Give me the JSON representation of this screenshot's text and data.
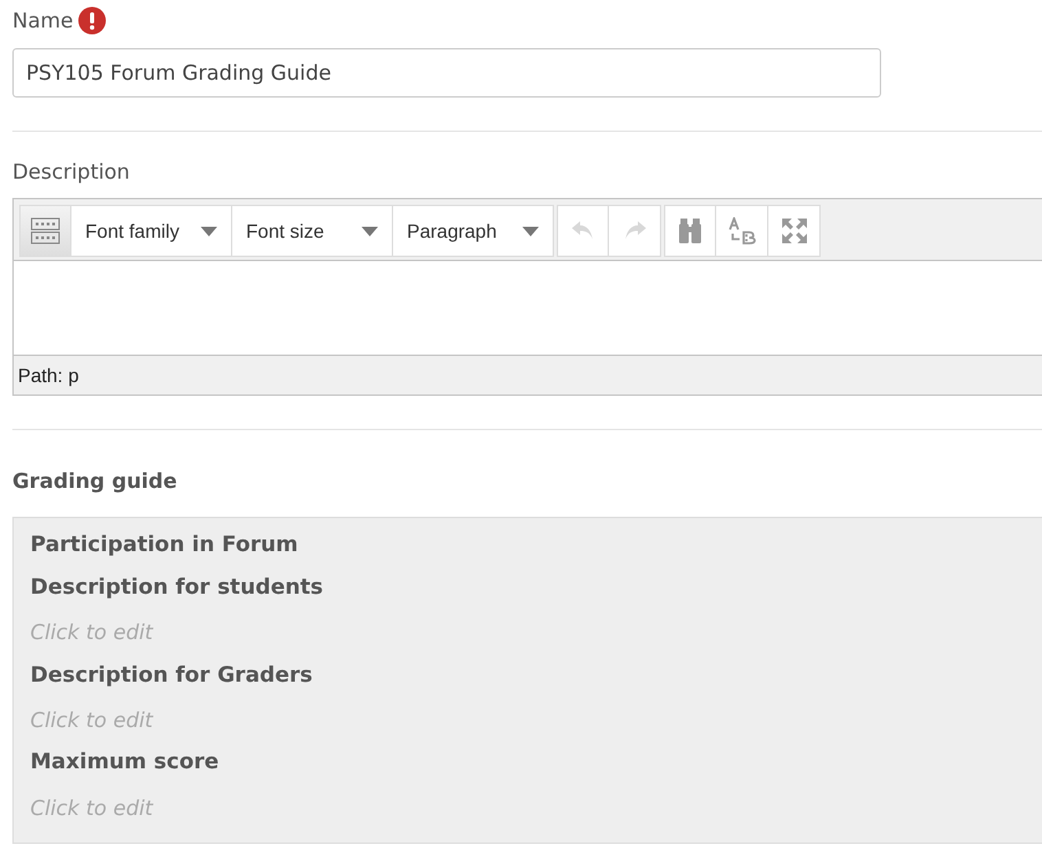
{
  "name_field": {
    "label": "Name",
    "required": true,
    "value": "PSY105 Forum Grading Guide"
  },
  "description": {
    "label": "Description",
    "toolbar": [
      {
        "kind": "toggle",
        "selected": true
      },
      {
        "kind": "dropdown",
        "label": "Font family"
      },
      {
        "kind": "dropdown",
        "label": "Font size"
      },
      {
        "kind": "dropdown",
        "label": "Paragraph"
      },
      {
        "kind": "undo",
        "disabled": true
      },
      {
        "kind": "redo",
        "disabled": true
      },
      {
        "kind": "find",
        "disabled": false
      },
      {
        "kind": "replace",
        "disabled": false
      },
      {
        "kind": "fullscreen",
        "disabled": false
      }
    ],
    "path": "Path: p"
  },
  "grading_guide": {
    "heading": "Grading guide",
    "criterion": "Participation in Forum",
    "sections": [
      {
        "label": "Description for students",
        "placeholder": "Click to edit"
      },
      {
        "label": "Description for Graders",
        "placeholder": "Click to edit"
      },
      {
        "label": "Maximum score",
        "placeholder": "Click to edit"
      }
    ]
  }
}
